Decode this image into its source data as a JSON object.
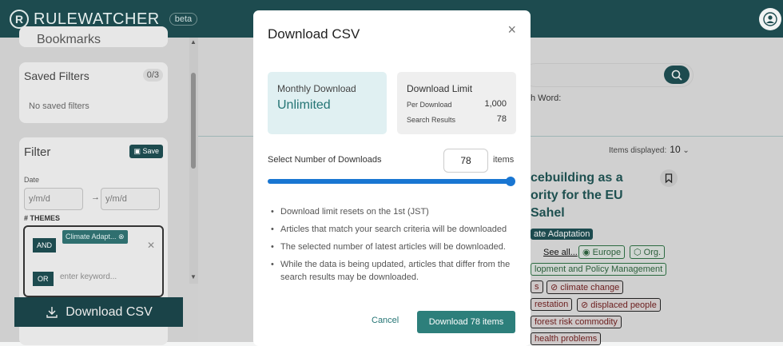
{
  "app": {
    "name": "RULEWATCHER",
    "badge": "beta",
    "logo_letter": "R"
  },
  "colors": {
    "brand": "#1d4b4f",
    "accent": "#257575",
    "slider": "#1976d2"
  },
  "sidebar": {
    "bookmarks_label": "Bookmarks",
    "saved_filters": {
      "title": "Saved Filters",
      "count": "0/3",
      "empty": "No saved filters"
    },
    "filter": {
      "title": "Filter",
      "save_label": "Save",
      "date_label": "Date",
      "date_from_placeholder": "y/m/d",
      "date_to_placeholder": "y/m/d",
      "arrow": "→",
      "themes_label": "# THEMES",
      "and_label": "AND",
      "chip": "Climate Adapt...",
      "or_label": "OR",
      "keyword_placeholder": "enter keyword..."
    },
    "download_button": "Download CSV"
  },
  "background": {
    "search_word_label": "h Word:",
    "items_displayed_label": "Items displayed:",
    "items_displayed_value": "10",
    "article_title": "cebuilding as a ority for the EU Sahel",
    "tags": [
      {
        "text": "ate Adaptation",
        "style": "dark"
      },
      {
        "text": "See all...",
        "style": "plain"
      },
      {
        "text": "Europe",
        "style": "green"
      },
      {
        "text": "Org.",
        "style": "green"
      },
      {
        "text": "lopment and Policy Management",
        "style": "green"
      },
      {
        "text": "s",
        "style": "red"
      },
      {
        "text": "climate change",
        "style": "red"
      },
      {
        "text": "restation",
        "style": "red"
      },
      {
        "text": "displaced people",
        "style": "red"
      },
      {
        "text": "forest risk commodity",
        "style": "red"
      },
      {
        "text": "health problems",
        "style": "red"
      }
    ]
  },
  "modal": {
    "title": "Download CSV",
    "close_icon": "×",
    "monthly": {
      "label": "Monthly Download",
      "value": "Unlimited"
    },
    "limit": {
      "label": "Download Limit",
      "per_download_label": "Per Download",
      "per_download_value": "1,000",
      "search_results_label": "Search Results",
      "search_results_value": "78"
    },
    "select_label": "Select Number of Downloads",
    "selected_value": "78",
    "items_suffix": "items",
    "slider_fraction": 1.0,
    "notes": [
      "Download limit resets on the 1st (JST)",
      "Articles that match your search criteria will be downloaded",
      "The selected number of latest articles will be downloaded.",
      "While the data is being updated, articles that differ from the search results may be downloaded."
    ],
    "cancel_label": "Cancel",
    "download_label": "Download 78 items"
  }
}
